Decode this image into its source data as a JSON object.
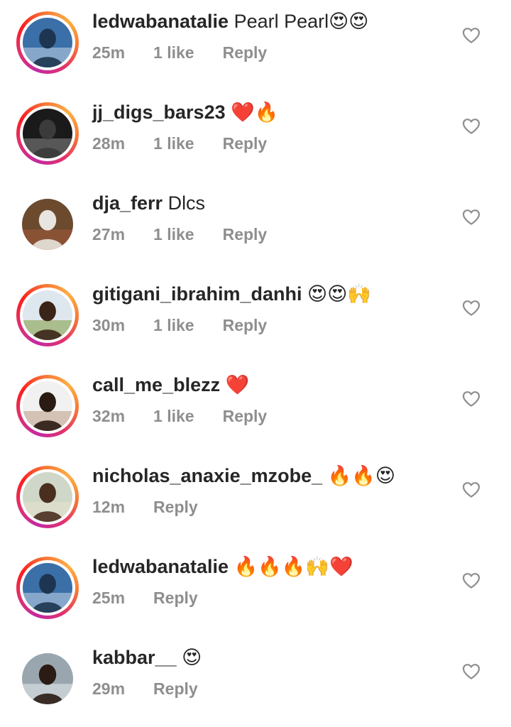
{
  "colors": {
    "username": "#262626",
    "meta": "#8e8e8e",
    "heart_outline": "#8e8e8e"
  },
  "icons": {
    "like": "heart-outline-icon"
  },
  "comments": [
    {
      "username": "ledwabanatalie",
      "text": " Pearl Pearl😍😍",
      "time": "25m",
      "likes": "1 like",
      "reply": "Reply",
      "story_ring": true,
      "avatar_tones": [
        "#3a6fa8",
        "#1d3550",
        "#c7d6e6"
      ]
    },
    {
      "username": "jj_digs_bars23",
      "text": " ❤️🔥",
      "time": "28m",
      "likes": "1 like",
      "reply": "Reply",
      "story_ring": true,
      "avatar_tones": [
        "#1a1a1a",
        "#3b3b3b",
        "#8a8a8a"
      ]
    },
    {
      "username": "dja_ferr",
      "text": " Dlcs",
      "time": "27m",
      "likes": "1 like",
      "reply": "Reply",
      "story_ring": false,
      "avatar_tones": [
        "#6b4a2e",
        "#e8e4df",
        "#a45a3a"
      ]
    },
    {
      "username": "gitigani_ibrahim_danhi",
      "text": " 😍😍🙌",
      "time": "30m",
      "likes": "1 like",
      "reply": "Reply",
      "story_ring": true,
      "avatar_tones": [
        "#dfe7ee",
        "#3a2418",
        "#7d9a3c"
      ]
    },
    {
      "username": "call_me_blezz",
      "text": " ❤️",
      "time": "32m",
      "likes": "1 like",
      "reply": "Reply",
      "story_ring": true,
      "avatar_tones": [
        "#f1f1f1",
        "#2a1a12",
        "#b99a84"
      ]
    },
    {
      "username": "nicholas_anaxie_mzobe_",
      "text": " 🔥🔥😍",
      "time": "12m",
      "likes": "",
      "reply": "Reply",
      "story_ring": true,
      "avatar_tones": [
        "#cfd8c8",
        "#4a2e1e",
        "#e9e2cf"
      ]
    },
    {
      "username": "ledwabanatalie",
      "text": " 🔥🔥🔥🙌❤️",
      "time": "25m",
      "likes": "",
      "reply": "Reply",
      "story_ring": true,
      "avatar_tones": [
        "#3a6fa8",
        "#1d3550",
        "#c7d6e6"
      ]
    },
    {
      "username": "kabbar__",
      "text": " 😍",
      "time": "29m",
      "likes": "",
      "reply": "Reply",
      "story_ring": false,
      "avatar_tones": [
        "#9aa6ad",
        "#2a1b14",
        "#e8ecef"
      ]
    }
  ]
}
